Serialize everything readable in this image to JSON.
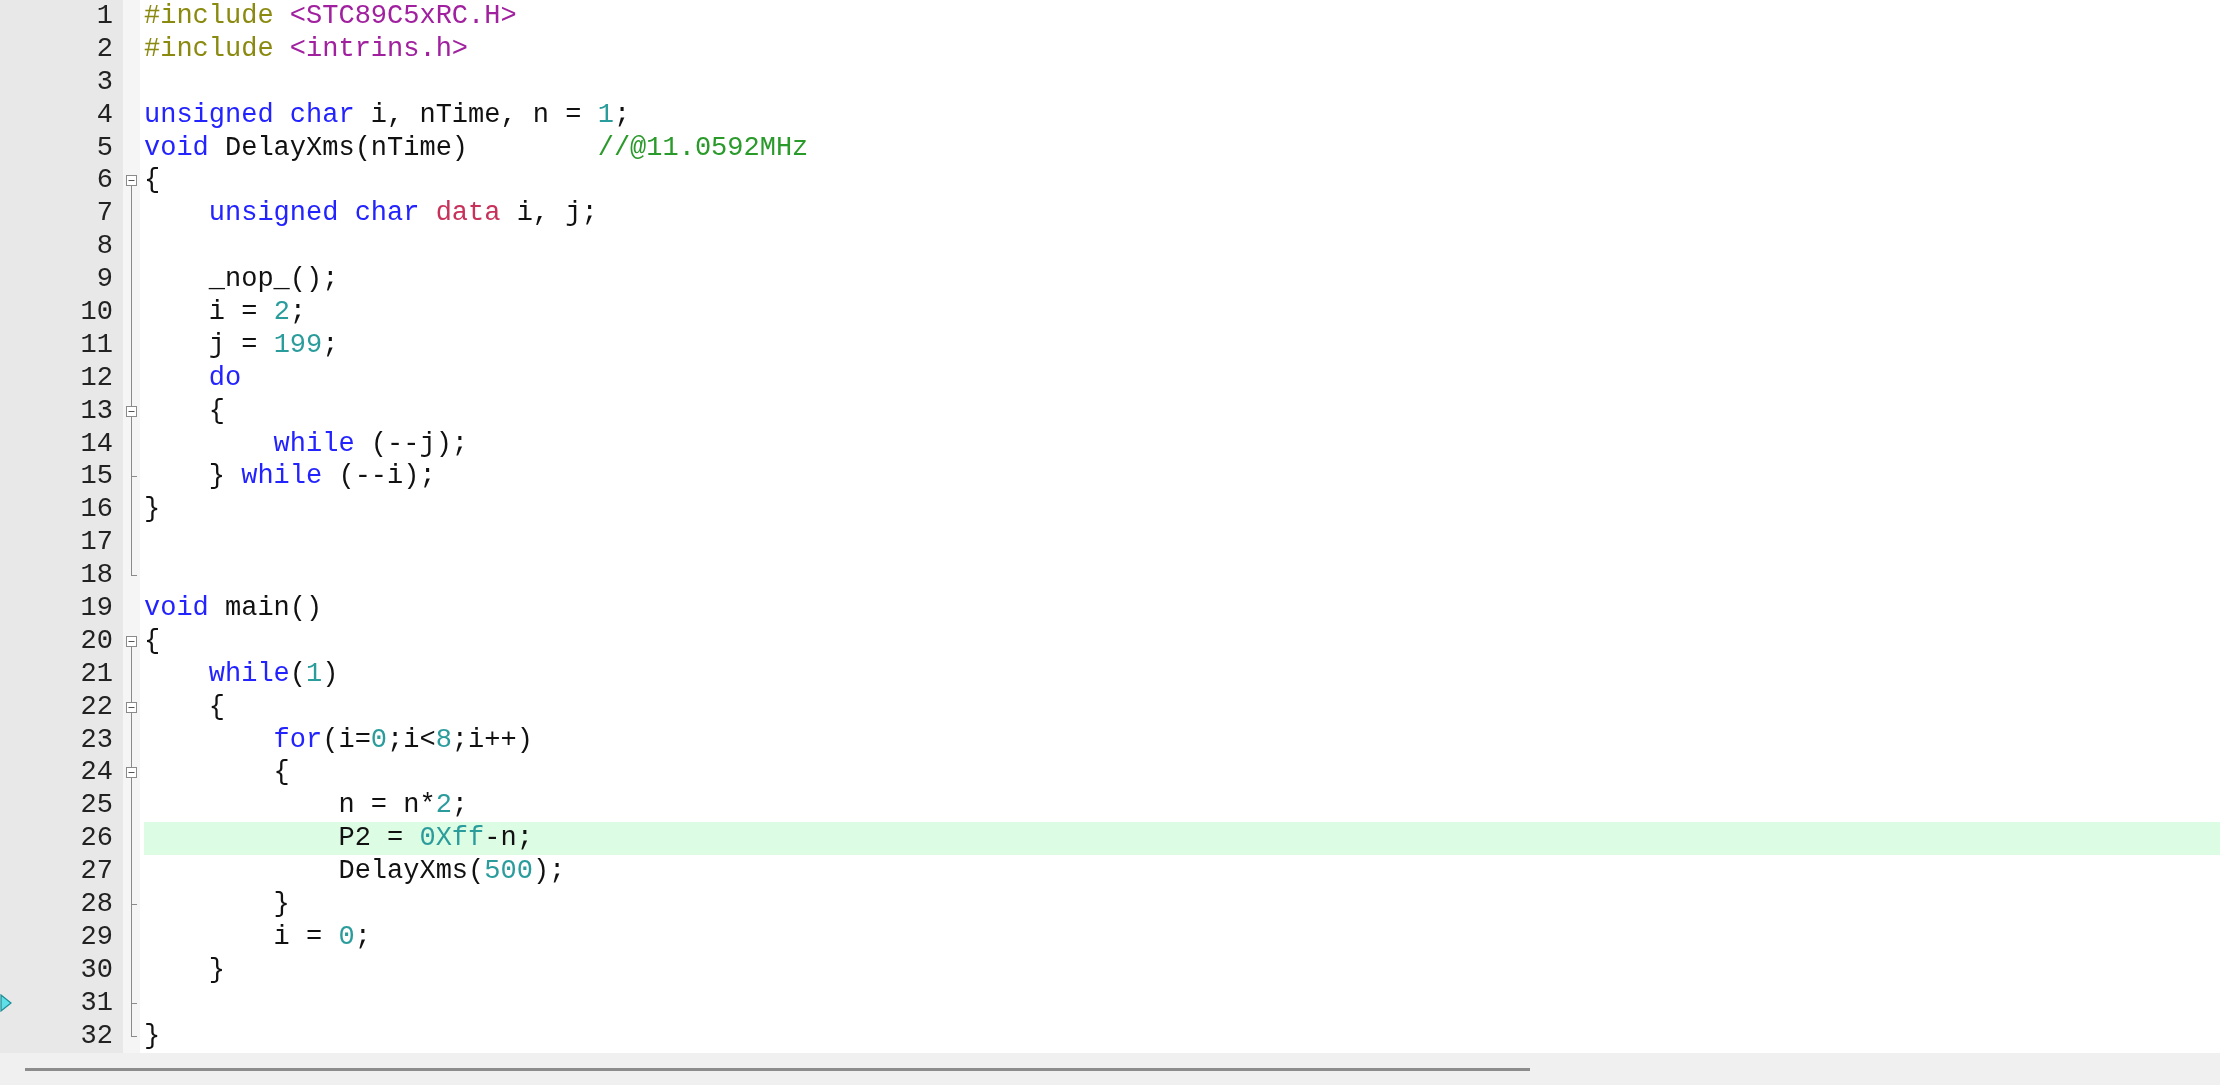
{
  "editor": {
    "lines": [
      {
        "number": "1",
        "kind": "plain",
        "highlighted": false,
        "arrow": false,
        "code": [
          {
            "kind": "preproc",
            "text": "#include"
          },
          {
            "kind": "path",
            "text": " <STC89C5xRC.H>"
          }
        ]
      },
      {
        "number": "2",
        "kind": "plain",
        "highlighted": false,
        "arrow": false,
        "code": [
          {
            "kind": "preproc",
            "text": "#include"
          },
          {
            "kind": "path",
            "text": " <intrins.h>"
          }
        ]
      },
      {
        "number": "3",
        "kind": "plain",
        "highlighted": false,
        "arrow": false
      },
      {
        "number": "4",
        "kind": "plain",
        "highlighted": false,
        "arrow": false,
        "code": [
          {
            "kind": "keyword",
            "text": "unsigned"
          },
          {
            "kind": "keyword",
            "text": " char"
          },
          {
            "kind": "plain",
            "text": " i, nTime, n = "
          },
          {
            "kind": "number",
            "text": "1"
          },
          {
            "kind": "plain",
            "text": ";"
          }
        ]
      },
      {
        "number": "5",
        "kind": "plain",
        "highlighted": false,
        "arrow": false,
        "code": [
          {
            "kind": "keyword",
            "text": "void"
          },
          {
            "kind": "plain",
            "text": " DelayXms(nTime)        "
          },
          {
            "kind": "comment",
            "text": "//@11.0592MHz"
          }
        ]
      },
      {
        "number": "6",
        "kind": "fold-start",
        "highlighted": false,
        "arrow": false,
        "code": [
          {
            "kind": "plain",
            "text": "{"
          }
        ]
      },
      {
        "number": "7",
        "kind": "fold-line",
        "highlighted": false,
        "arrow": false,
        "code": [
          {
            "kind": "keyword",
            "text": "    unsigned"
          },
          {
            "kind": "keyword",
            "text": " char"
          },
          {
            "kind": "storage",
            "text": " data"
          },
          {
            "kind": "plain",
            "text": " i, j;"
          }
        ]
      },
      {
        "number": "8",
        "kind": "fold-line",
        "highlighted": false,
        "arrow": false
      },
      {
        "number": "9",
        "kind": "fold-line",
        "highlighted": false,
        "arrow": false,
        "code": [
          {
            "kind": "plain",
            "text": "    _nop_();"
          }
        ]
      },
      {
        "number": "10",
        "kind": "fold-line",
        "highlighted": false,
        "arrow": false,
        "code": [
          {
            "kind": "plain",
            "text": "    i = "
          },
          {
            "kind": "number",
            "text": "2"
          },
          {
            "kind": "plain",
            "text": ";"
          }
        ]
      },
      {
        "number": "11",
        "kind": "fold-line",
        "highlighted": false,
        "arrow": false,
        "code": [
          {
            "kind": "plain",
            "text": "    j = "
          },
          {
            "kind": "number",
            "text": "199"
          },
          {
            "kind": "plain",
            "text": ";"
          }
        ]
      },
      {
        "number": "12",
        "kind": "fold-line",
        "highlighted": false,
        "arrow": false,
        "code": [
          {
            "kind": "keyword",
            "text": "    do"
          }
        ]
      },
      {
        "number": "13",
        "kind": "fold-nested-start",
        "highlighted": false,
        "arrow": false,
        "code": [
          {
            "kind": "plain",
            "text": "    {"
          }
        ]
      },
      {
        "number": "14",
        "kind": "fold-line",
        "highlighted": false,
        "arrow": false,
        "code": [
          {
            "kind": "keyword",
            "text": "        while"
          },
          {
            "kind": "plain",
            "text": " (--j);"
          }
        ]
      },
      {
        "number": "15",
        "kind": "fold-tick",
        "highlighted": false,
        "arrow": false,
        "code": [
          {
            "kind": "plain",
            "text": "    }"
          },
          {
            "kind": "keyword",
            "text": " while"
          },
          {
            "kind": "plain",
            "text": " (--i);"
          }
        ]
      },
      {
        "number": "16",
        "kind": "fold-line",
        "highlighted": false,
        "arrow": false,
        "code": [
          {
            "kind": "plain",
            "text": "}"
          }
        ]
      },
      {
        "number": "17",
        "kind": "fold-line",
        "highlighted": false,
        "arrow": false
      },
      {
        "number": "18",
        "kind": "fold-end",
        "highlighted": false,
        "arrow": false
      },
      {
        "number": "19",
        "kind": "plain",
        "highlighted": false,
        "arrow": false,
        "code": [
          {
            "kind": "keyword",
            "text": "void"
          },
          {
            "kind": "plain",
            "text": " main()"
          }
        ]
      },
      {
        "number": "20",
        "kind": "fold-start",
        "highlighted": false,
        "arrow": false,
        "code": [
          {
            "kind": "plain",
            "text": "{"
          }
        ]
      },
      {
        "number": "21",
        "kind": "fold-line",
        "highlighted": false,
        "arrow": false,
        "code": [
          {
            "kind": "keyword",
            "text": "    while"
          },
          {
            "kind": "plain",
            "text": "("
          },
          {
            "kind": "number",
            "text": "1"
          },
          {
            "kind": "plain",
            "text": ")"
          }
        ]
      },
      {
        "number": "22",
        "kind": "fold-nested-start",
        "highlighted": false,
        "arrow": false,
        "code": [
          {
            "kind": "plain",
            "text": "    {"
          }
        ]
      },
      {
        "number": "23",
        "kind": "fold-line",
        "highlighted": false,
        "arrow": false,
        "code": [
          {
            "kind": "keyword",
            "text": "        for"
          },
          {
            "kind": "plain",
            "text": "(i="
          },
          {
            "kind": "number",
            "text": "0"
          },
          {
            "kind": "plain",
            "text": ";i<"
          },
          {
            "kind": "number",
            "text": "8"
          },
          {
            "kind": "plain",
            "text": ";i++)"
          }
        ]
      },
      {
        "number": "24",
        "kind": "fold-nested-start",
        "highlighted": false,
        "arrow": false,
        "code": [
          {
            "kind": "plain",
            "text": "        {"
          }
        ]
      },
      {
        "number": "25",
        "kind": "fold-line",
        "highlighted": false,
        "arrow": false,
        "code": [
          {
            "kind": "plain",
            "text": "            n = n*"
          },
          {
            "kind": "number",
            "text": "2"
          },
          {
            "kind": "plain",
            "text": ";"
          }
        ]
      },
      {
        "number": "26",
        "kind": "fold-line",
        "highlighted": true,
        "arrow": false,
        "code": [
          {
            "kind": "plain",
            "text": "            P2 = "
          },
          {
            "kind": "number",
            "text": "0Xff"
          },
          {
            "kind": "plain",
            "text": "-n;"
          }
        ]
      },
      {
        "number": "27",
        "kind": "fold-line",
        "highlighted": false,
        "arrow": false,
        "code": [
          {
            "kind": "plain",
            "text": "            DelayXms("
          },
          {
            "kind": "number",
            "text": "500"
          },
          {
            "kind": "plain",
            "text": ");"
          }
        ]
      },
      {
        "number": "28",
        "kind": "fold-tick",
        "highlighted": false,
        "arrow": false,
        "code": [
          {
            "kind": "plain",
            "text": "        }"
          }
        ]
      },
      {
        "number": "29",
        "kind": "fold-line",
        "highlighted": false,
        "arrow": false,
        "code": [
          {
            "kind": "plain",
            "text": "        i = "
          },
          {
            "kind": "number",
            "text": "0"
          },
          {
            "kind": "plain",
            "text": ";"
          }
        ]
      },
      {
        "number": "30",
        "kind": "fold-line",
        "highlighted": false,
        "arrow": false,
        "code": [
          {
            "kind": "plain",
            "text": "    }"
          }
        ]
      },
      {
        "number": "31",
        "kind": "fold-tick",
        "highlighted": false,
        "arrow": true
      },
      {
        "number": "32",
        "kind": "fold-end",
        "highlighted": false,
        "arrow": false,
        "code": [
          {
            "kind": "plain",
            "text": "}"
          }
        ]
      }
    ]
  }
}
